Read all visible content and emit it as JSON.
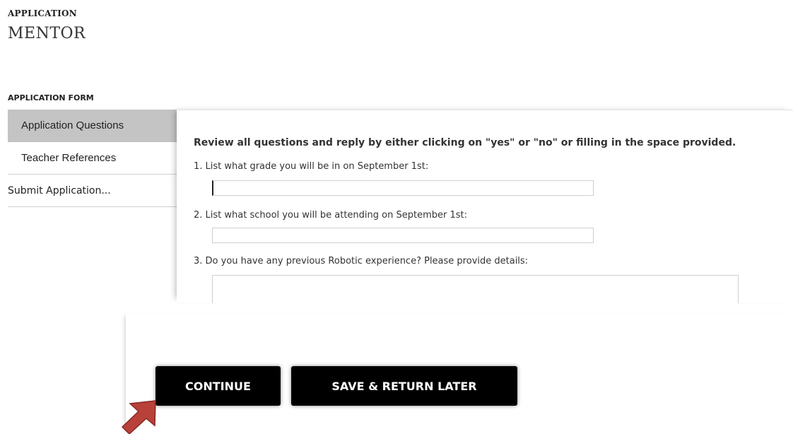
{
  "header": {
    "app_label": "APPLICATION",
    "app_title": "MENTOR",
    "form_label": "APPLICATION FORM"
  },
  "sidebar": {
    "items": [
      {
        "label": "Application Questions",
        "active": true
      },
      {
        "label": "Teacher References",
        "active": false
      },
      {
        "label": "Submit Application...",
        "active": false
      }
    ]
  },
  "main": {
    "instructions": "Review all questions and reply by either clicking on \"yes\" or \"no\" or filling in the space provided.",
    "questions": [
      {
        "label": "1. List what grade you will be in on September 1st:",
        "value": ""
      },
      {
        "label": "2. List what school you will be attending on September 1st:",
        "value": ""
      },
      {
        "label": "3. Do you have any previous Robotic experience? Please provide details:",
        "value": ""
      }
    ]
  },
  "actions": {
    "continue_label": "CONTINUE",
    "save_label": "SAVE & RETURN LATER"
  },
  "colors": {
    "active_nav": "#c4c4c4",
    "button_bg": "#000000",
    "button_text": "#ffffff",
    "arrow": "#b8413a"
  },
  "icons": {
    "pointer": "pointer-arrow-icon"
  }
}
